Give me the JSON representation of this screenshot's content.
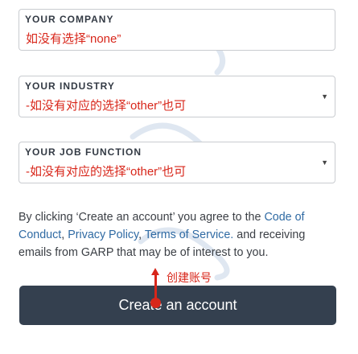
{
  "company": {
    "label": "YOUR COMPANY",
    "value": "如没有选择“none”"
  },
  "industry": {
    "label": "YOUR INDUSTRY",
    "value": "-如没有对应的选择“other”也可"
  },
  "job_function": {
    "label": "YOUR JOB FUNCTION",
    "value": "-如没有对应的选择“other”也可"
  },
  "consent": {
    "prefix": "By clicking ‘Create an account’ you agree to the ",
    "code_of_conduct": "Code of Conduct",
    "sep1": ", ",
    "privacy_policy": "Privacy Policy",
    "sep2": ", ",
    "terms_of_service": "Terms of Service.",
    "suffix": " and receiving emails from GARP that may be of interest to you."
  },
  "annotation": "创建账号",
  "create_button": "Create an account",
  "colors": {
    "annotation_red": "#d8261a",
    "link_blue": "#2f6aa3",
    "button_bg": "#34404f"
  },
  "icons": {
    "dropdown": "caret-down-icon"
  }
}
